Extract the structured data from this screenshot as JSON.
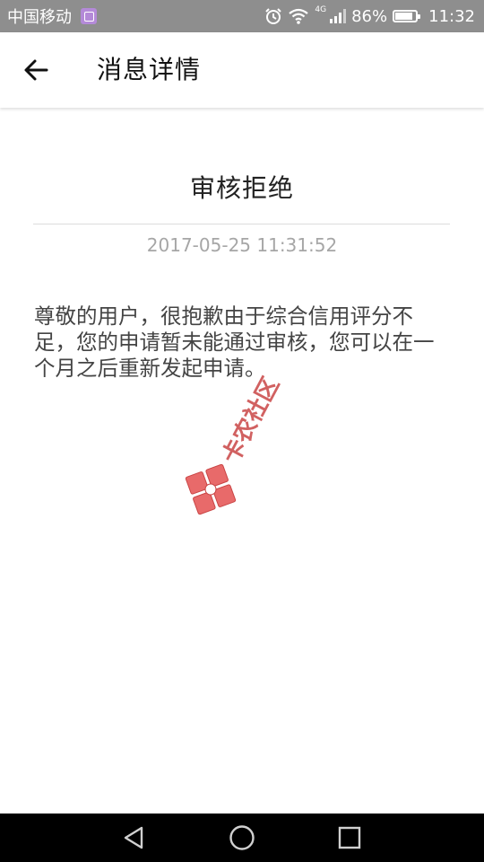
{
  "status_bar": {
    "carrier": "中国移动",
    "network": "4G",
    "battery_percent": "86%",
    "time": "11:32",
    "icons": [
      "app-notification-icon",
      "alarm-icon",
      "wifi-icon",
      "signal-icon",
      "battery-icon"
    ]
  },
  "app_bar": {
    "title": "消息详情",
    "back_icon": "back-arrow-icon"
  },
  "message": {
    "title": "审核拒绝",
    "timestamp": "2017-05-25 11:31:52",
    "body": "尊敬的用户，很抱歉由于综合信用评分不足，您的申请暂未能通过审核，您可以在一个月之后重新发起申请。"
  },
  "watermark": {
    "text": "卡农社区",
    "color": "#e05555"
  },
  "nav_bar": {
    "icons": [
      "back-triangle-icon",
      "home-circle-icon",
      "recents-square-icon"
    ]
  },
  "colors": {
    "status_bar_bg": "#8e8e8e",
    "title_text": "#111111",
    "body_text": "#444444",
    "time_text": "#a6a6a6",
    "divider": "#dcdcdc",
    "nav_bar_bg": "#000000"
  }
}
